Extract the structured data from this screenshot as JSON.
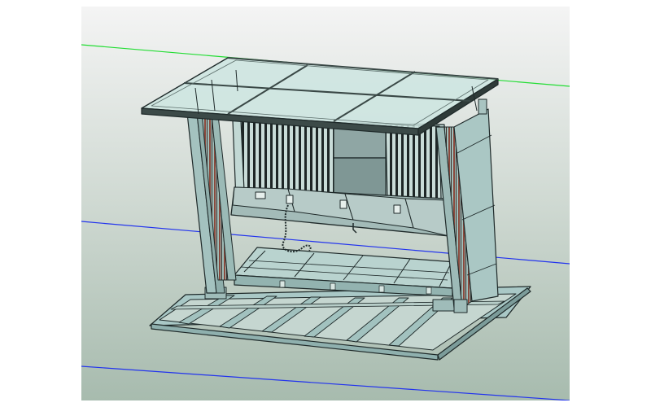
{
  "viewport": {
    "background_top": "#f2f2f2",
    "background_bottom": "#a9bdb0",
    "axis_green": "#22dd33",
    "axis_blue": "#2233ee",
    "model_fill": "#a7c6c4",
    "model_stroke": "#1f2a2a",
    "glass_fill": "#cfe8e3",
    "coil_accent": "#8a4a3e",
    "model_icon": "3d-cad-model"
  }
}
